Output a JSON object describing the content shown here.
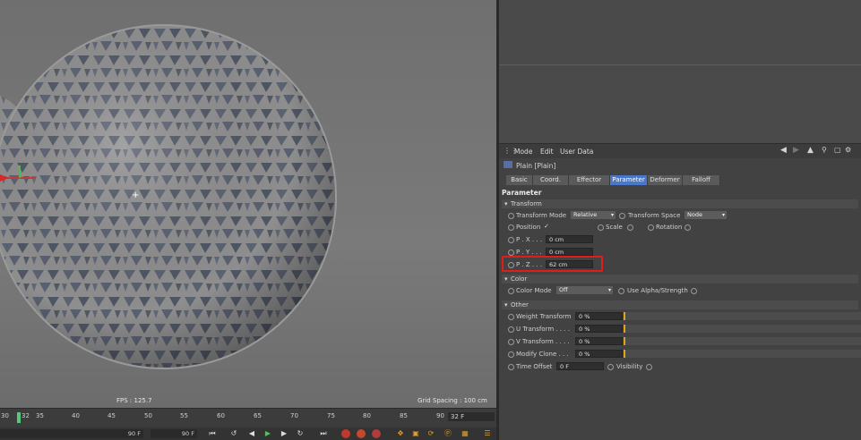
{
  "viewport": {
    "fps": "FPS : 125.7",
    "grid_spacing": "Grid Spacing : 100 cm"
  },
  "attribute_manager": {
    "menu": [
      "Mode",
      "Edit",
      "User Data"
    ],
    "object_name": "Plain [Plain]",
    "tabs": [
      "Basic",
      "Coord.",
      "Effector",
      "Parameter",
      "Deformer",
      "Falloff"
    ],
    "active_tab": "Parameter",
    "section_title": "Parameter",
    "transform": {
      "title": "Transform",
      "transform_mode_label": "Transform Mode",
      "transform_mode_value": "Relative",
      "transform_space_label": "Transform Space",
      "transform_space_value": "Node",
      "position_label": "Position",
      "position_check": "✓",
      "scale_label": "Scale",
      "rotation_label": "Rotation",
      "px_label": "P . X . . .",
      "px_value": "0 cm",
      "py_label": "P . Y . . .",
      "py_value": "0 cm",
      "pz_label": "P . Z . . .",
      "pz_value": "62 cm"
    },
    "color": {
      "title": "Color",
      "color_mode_label": "Color Mode",
      "color_mode_value": "Off",
      "alpha_label": "Use Alpha/Strength"
    },
    "other": {
      "title": "Other",
      "rows": [
        {
          "label": "Weight Transform",
          "value": "0 %"
        },
        {
          "label": "U Transform . . . .",
          "value": "0 %"
        },
        {
          "label": "V Transform . . . .",
          "value": "0 %"
        },
        {
          "label": "Modify Clone . . .",
          "value": "0 %"
        }
      ],
      "time_offset_label": "Time Offset",
      "time_offset_value": "0 F",
      "visibility_label": "Visibility"
    }
  },
  "timeline": {
    "ticks": [
      "30",
      "32",
      "35",
      "40",
      "45",
      "50",
      "55",
      "60",
      "65",
      "70",
      "75",
      "80",
      "85",
      "90"
    ],
    "current_frame": "32 F",
    "start_field": "90 F",
    "end_field": "90 F"
  },
  "colors": {
    "accent": "#4a78c8",
    "highlight": "#e21b1b",
    "slider_knob": "#e3a21a"
  }
}
